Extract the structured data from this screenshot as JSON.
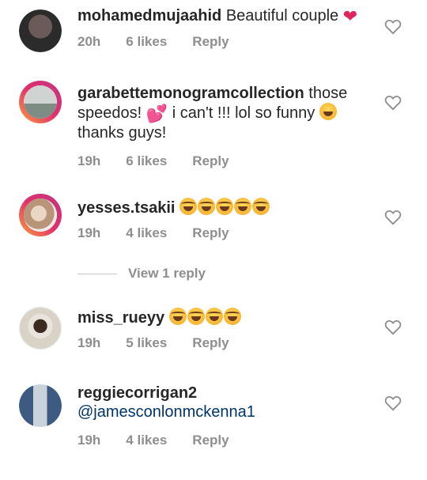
{
  "comments": [
    {
      "username": "mohamedmujaahid",
      "text": "Beautiful couple",
      "time": "20h",
      "likes": "6 likes",
      "reply": "Reply"
    },
    {
      "username": "garabettemonogramcollection",
      "text_before": "those speedos!",
      "text_after": "i can't !!! lol so funny",
      "text_end": "thanks guys!",
      "time": "19h",
      "likes": "6 likes",
      "reply": "Reply"
    },
    {
      "username": "yesses.tsakii",
      "time": "19h",
      "likes": "4 likes",
      "reply": "Reply",
      "view_replies": "View 1 reply"
    },
    {
      "username": "miss_rueyy",
      "time": "19h",
      "likes": "5 likes",
      "reply": "Reply"
    },
    {
      "username": "reggiecorrigan2",
      "mention": "@jamesconlonmckenna1",
      "time": "19h",
      "likes": "4 likes",
      "reply": "Reply"
    }
  ],
  "colors": {
    "heart": "#e0245e",
    "meta": "#8e8e8e",
    "mention": "#003569"
  }
}
